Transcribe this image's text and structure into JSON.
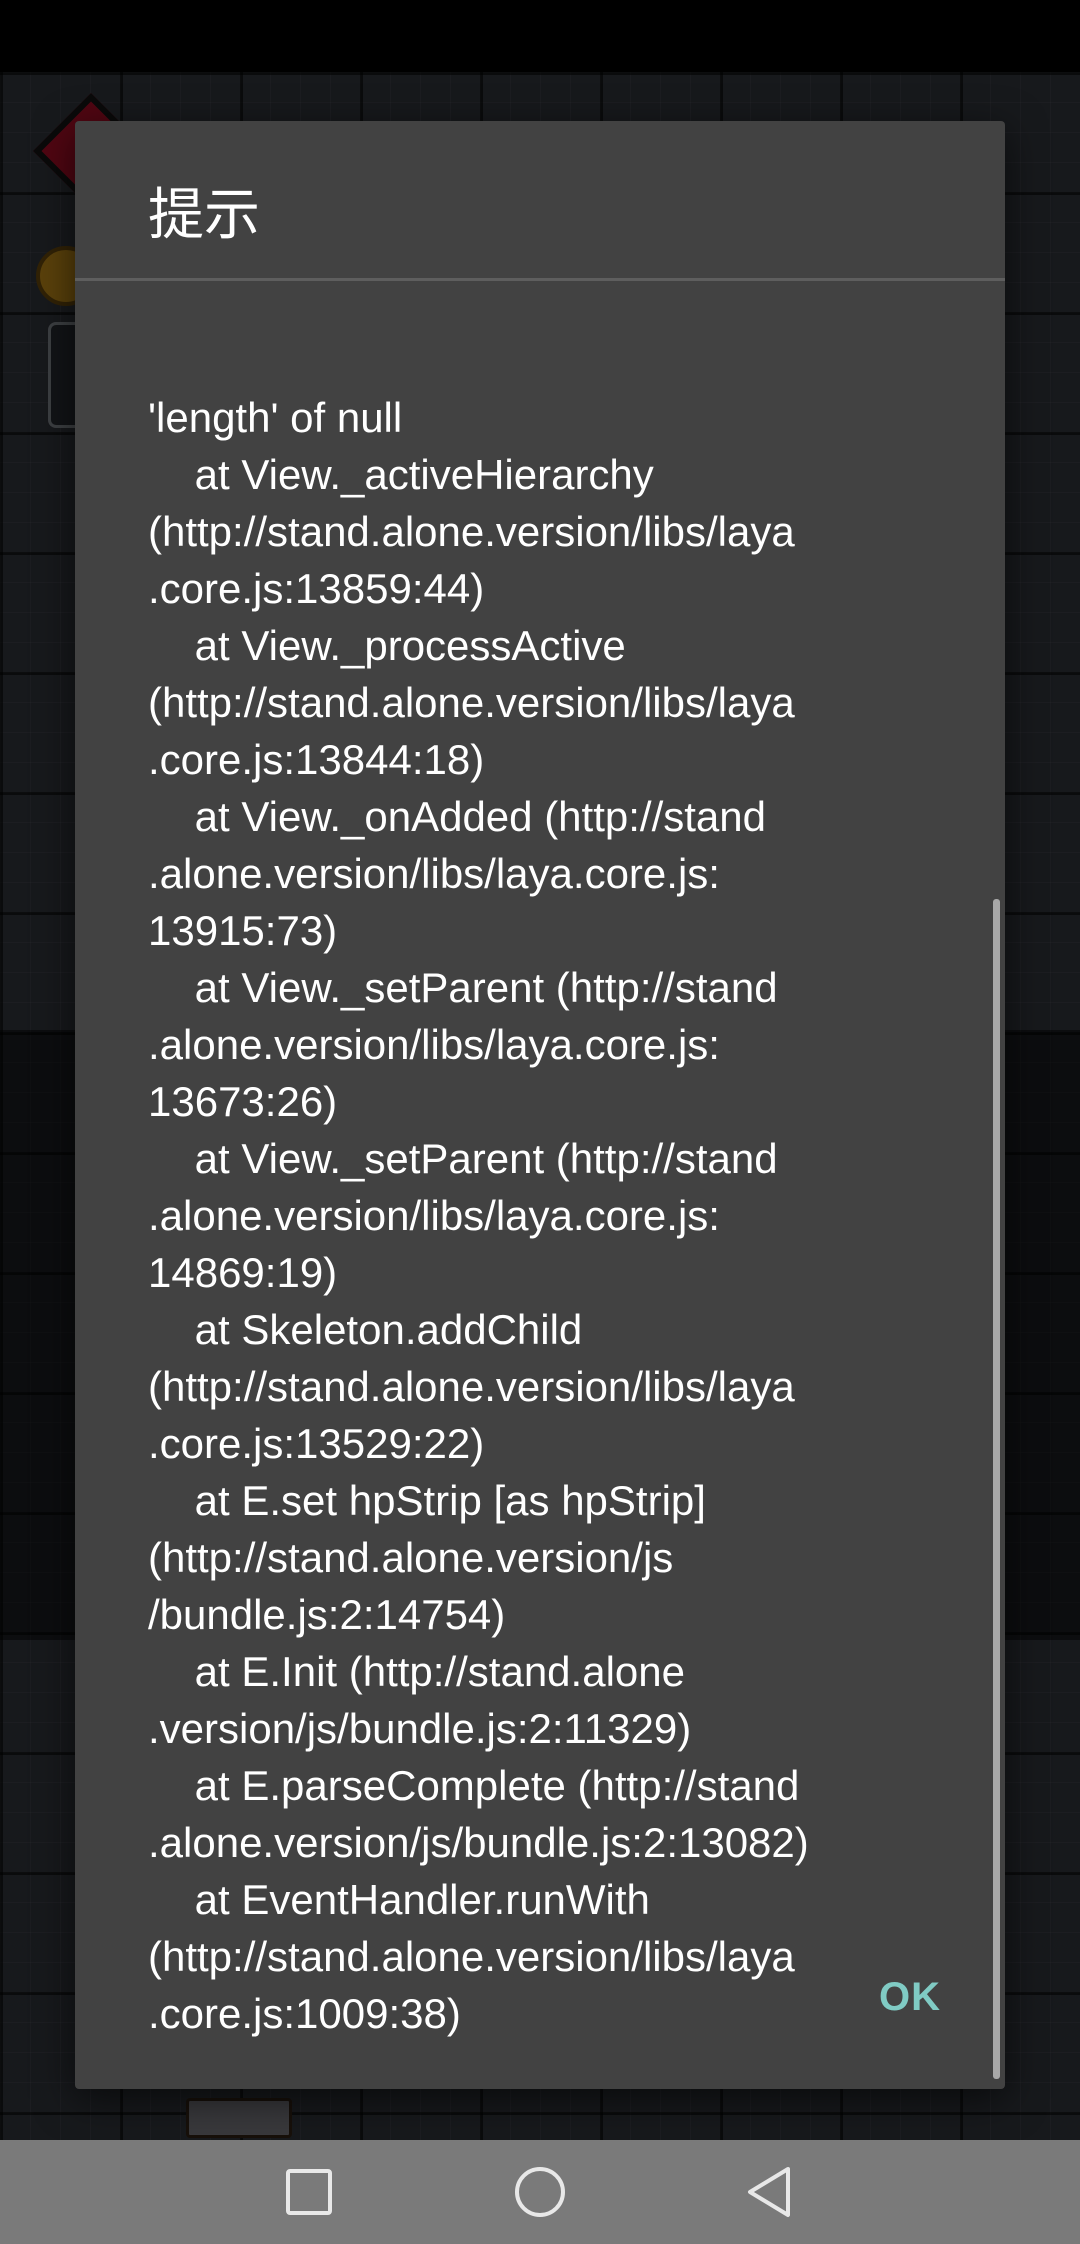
{
  "dialog": {
    "title": "提示",
    "message_lines": [
      "'length' of null",
      "    at View._activeHierarchy",
      "(http://stand.alone.version/libs/laya",
      ".core.js:13859:44)",
      "    at View._processActive",
      "(http://stand.alone.version/libs/laya",
      ".core.js:13844:18)",
      "    at View._onAdded (http://stand",
      ".alone.version/libs/laya.core.js:",
      "13915:73)",
      "    at View._setParent (http://stand",
      ".alone.version/libs/laya.core.js:",
      "13673:26)",
      "    at View._setParent (http://stand",
      ".alone.version/libs/laya.core.js:",
      "14869:19)",
      "    at Skeleton.addChild",
      "(http://stand.alone.version/libs/laya",
      ".core.js:13529:22)",
      "    at E.set hpStrip [as hpStrip]",
      "(http://stand.alone.version/js",
      "/bundle.js:2:14754)",
      "    at E.Init (http://stand.alone",
      ".version/js/bundle.js:2:11329)",
      "    at E.parseComplete (http://stand",
      ".alone.version/js/bundle.js:2:13082)",
      "    at EventHandler.runWith",
      "(http://stand.alone.version/libs/laya",
      ".core.js:1009:38)"
    ],
    "ok_label": "OK"
  },
  "navigation_bar": {
    "buttons": [
      {
        "name": "recents",
        "icon": "square-icon"
      },
      {
        "name": "home",
        "icon": "circle-icon"
      },
      {
        "name": "back",
        "icon": "triangle-back-icon"
      }
    ]
  },
  "colors": {
    "dialog_background": "#424242",
    "accent": "#80cbc4",
    "text": "#ffffff",
    "navigation_bar": "#7a7a7a"
  }
}
